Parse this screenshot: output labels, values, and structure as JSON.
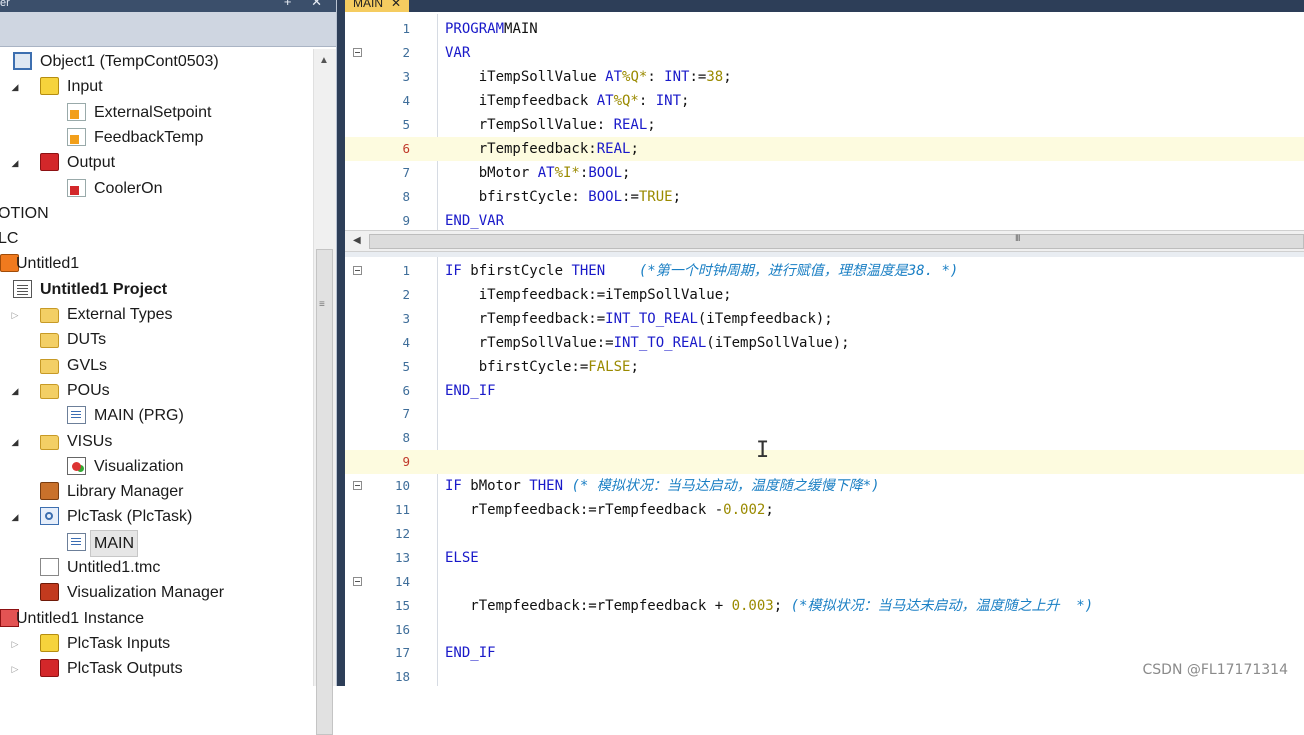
{
  "explorer": {
    "title_fragment": "er",
    "title_controls": "+ ✕",
    "items": [
      {
        "label": "Object1 (TempCont0503)",
        "icon": "object-icon",
        "expander": "",
        "bold": false,
        "selected": false
      },
      {
        "label": "Input",
        "icon": "input-image-icon",
        "expander": "◢",
        "bold": false,
        "selected": false
      },
      {
        "label": "ExternalSetpoint",
        "icon": "variable-link-icon",
        "expander": "",
        "bold": false,
        "selected": false
      },
      {
        "label": "FeedbackTemp",
        "icon": "variable-link-icon",
        "expander": "",
        "bold": false,
        "selected": false
      },
      {
        "label": "Output",
        "icon": "output-image-icon",
        "expander": "◢",
        "bold": false,
        "selected": false
      },
      {
        "label": "CoolerOn",
        "icon": "variable-link-icon",
        "expander": "",
        "bold": false,
        "selected": false
      },
      {
        "label": "OTION",
        "icon": "",
        "expander": "",
        "bold": false,
        "selected": false
      },
      {
        "label": "LC",
        "icon": "",
        "expander": "",
        "bold": false,
        "selected": false
      },
      {
        "label": "Untitled1",
        "icon": "plc-project-icon",
        "expander": "",
        "bold": false,
        "selected": false
      },
      {
        "label": "Untitled1 Project",
        "icon": "project-icon",
        "expander": "",
        "bold": true,
        "selected": false
      },
      {
        "label": "External Types",
        "icon": "folder-icon",
        "expander": "▷",
        "bold": false,
        "selected": false
      },
      {
        "label": "DUTs",
        "icon": "folder-icon",
        "expander": "",
        "bold": false,
        "selected": false
      },
      {
        "label": "GVLs",
        "icon": "folder-icon",
        "expander": "",
        "bold": false,
        "selected": false
      },
      {
        "label": "POUs",
        "icon": "folder-open-icon",
        "expander": "◢",
        "bold": false,
        "selected": false
      },
      {
        "label": "MAIN (PRG)",
        "icon": "program-icon",
        "expander": "",
        "bold": false,
        "selected": false
      },
      {
        "label": "VISUs",
        "icon": "folder-open-icon",
        "expander": "◢",
        "bold": false,
        "selected": false
      },
      {
        "label": "Visualization",
        "icon": "visualization-icon",
        "expander": "",
        "bold": false,
        "selected": false
      },
      {
        "label": "Library Manager",
        "icon": "library-icon",
        "expander": "",
        "bold": false,
        "selected": false
      },
      {
        "label": "PlcTask (PlcTask)",
        "icon": "task-icon",
        "expander": "◢",
        "bold": false,
        "selected": false
      },
      {
        "label": "MAIN",
        "icon": "program-call-icon",
        "expander": "",
        "bold": false,
        "selected": true
      },
      {
        "label": "Untitled1.tmc",
        "icon": "file-icon",
        "expander": "",
        "bold": false,
        "selected": false
      },
      {
        "label": "Visualization Manager",
        "icon": "visualization-manager-icon",
        "expander": "",
        "bold": false,
        "selected": false
      },
      {
        "label": "Untitled1 Instance",
        "icon": "instance-icon",
        "expander": "",
        "bold": false,
        "selected": false
      },
      {
        "label": "PlcTask Inputs",
        "icon": "input-image-icon",
        "expander": "▷",
        "bold": false,
        "selected": false
      },
      {
        "label": "PlcTask Outputs",
        "icon": "output-image-icon",
        "expander": "▷",
        "bold": false,
        "selected": false
      }
    ]
  },
  "editor": {
    "tab_label": "MAIN",
    "tab_close": "✕",
    "hscroll_grip": "III",
    "declaration_lines": [
      {
        "n": "1",
        "fold": false,
        "hl": false,
        "red": false,
        "tokens": [
          [
            "kw",
            "PROGRAM"
          ],
          [
            "",
            "MAIN"
          ]
        ]
      },
      {
        "n": "2",
        "fold": true,
        "hl": false,
        "red": false,
        "tokens": [
          [
            "kw",
            "VAR"
          ]
        ]
      },
      {
        "n": "3",
        "fold": false,
        "hl": false,
        "red": false,
        "tokens": [
          [
            "",
            "    iTempSollValue "
          ],
          [
            "kw",
            "AT"
          ],
          [
            "num",
            "%Q*"
          ],
          [
            "",
            ": "
          ],
          [
            "kw",
            "INT"
          ],
          [
            "",
            ":="
          ],
          [
            "num",
            "38"
          ],
          [
            "",
            ";"
          ]
        ]
      },
      {
        "n": "4",
        "fold": false,
        "hl": false,
        "red": false,
        "tokens": [
          [
            "",
            "    iTempfeedback "
          ],
          [
            "kw",
            "AT"
          ],
          [
            "num",
            "%Q*"
          ],
          [
            "",
            ": "
          ],
          [
            "kw",
            "INT"
          ],
          [
            "",
            ";"
          ]
        ]
      },
      {
        "n": "5",
        "fold": false,
        "hl": false,
        "red": false,
        "tokens": [
          [
            "",
            "    rTempSollValue: "
          ],
          [
            "kw",
            "REAL"
          ],
          [
            "",
            ";"
          ]
        ]
      },
      {
        "n": "6",
        "fold": false,
        "hl": true,
        "red": true,
        "tokens": [
          [
            "",
            "    rTempfeedback:"
          ],
          [
            "kw",
            "REAL"
          ],
          [
            "",
            ";"
          ]
        ]
      },
      {
        "n": "7",
        "fold": false,
        "hl": false,
        "red": false,
        "tokens": [
          [
            "",
            "    bMotor "
          ],
          [
            "kw",
            "AT"
          ],
          [
            "num",
            "%I*"
          ],
          [
            "",
            ":"
          ],
          [
            "kw",
            "BOOL"
          ],
          [
            "",
            ";"
          ]
        ]
      },
      {
        "n": "8",
        "fold": false,
        "hl": false,
        "red": false,
        "tokens": [
          [
            "",
            "    bfirstCycle: "
          ],
          [
            "kw",
            "BOOL"
          ],
          [
            "",
            ":="
          ],
          [
            "num",
            "TRUE"
          ],
          [
            "",
            ";"
          ]
        ]
      },
      {
        "n": "9",
        "fold": false,
        "hl": false,
        "red": false,
        "tokens": [
          [
            "kw",
            "END_VAR"
          ]
        ]
      }
    ],
    "implementation_lines": [
      {
        "n": "1",
        "fold": true,
        "hl": false,
        "red": false,
        "tokens": [
          [
            "kw",
            "IF"
          ],
          [
            "",
            " bfirstCycle "
          ],
          [
            "kw",
            "THEN"
          ],
          [
            "",
            "    "
          ],
          [
            "cm",
            "(*第一个时钟周期，进行赋值，理想温度是38. *)"
          ]
        ]
      },
      {
        "n": "2",
        "fold": false,
        "hl": false,
        "red": false,
        "tokens": [
          [
            "",
            "    iTempfeedback:=iTempSollValue;"
          ]
        ]
      },
      {
        "n": "3",
        "fold": false,
        "hl": false,
        "red": false,
        "tokens": [
          [
            "",
            "    rTempfeedback:="
          ],
          [
            "kw",
            "INT_TO_REAL"
          ],
          [
            "",
            "(iTempfeedback);"
          ]
        ]
      },
      {
        "n": "4",
        "fold": false,
        "hl": false,
        "red": false,
        "tokens": [
          [
            "",
            "    rTempSollValue:="
          ],
          [
            "kw",
            "INT_TO_REAL"
          ],
          [
            "",
            "(iTempSollValue);"
          ]
        ]
      },
      {
        "n": "5",
        "fold": false,
        "hl": false,
        "red": false,
        "tokens": [
          [
            "",
            "    bfirstCycle:="
          ],
          [
            "num",
            "FALSE"
          ],
          [
            "",
            ";"
          ]
        ]
      },
      {
        "n": "6",
        "fold": false,
        "hl": false,
        "red": false,
        "tokens": [
          [
            "kw",
            "END_IF"
          ]
        ]
      },
      {
        "n": "7",
        "fold": false,
        "hl": false,
        "red": false,
        "tokens": []
      },
      {
        "n": "8",
        "fold": false,
        "hl": false,
        "red": false,
        "tokens": []
      },
      {
        "n": "9",
        "fold": false,
        "hl": true,
        "red": true,
        "tokens": []
      },
      {
        "n": "10",
        "fold": true,
        "hl": false,
        "red": false,
        "tokens": [
          [
            "kw",
            "IF"
          ],
          [
            "",
            " bMotor "
          ],
          [
            "kw",
            "THEN"
          ],
          [
            "",
            " "
          ],
          [
            "cm",
            "(* 模拟状况：当马达启动，温度随之缓慢下降*)"
          ]
        ]
      },
      {
        "n": "11",
        "fold": false,
        "hl": false,
        "red": false,
        "tokens": [
          [
            "",
            "   rTempfeedback:=rTempfeedback -"
          ],
          [
            "num",
            "0.002"
          ],
          [
            "",
            ";"
          ]
        ]
      },
      {
        "n": "12",
        "fold": false,
        "hl": false,
        "red": false,
        "tokens": []
      },
      {
        "n": "13",
        "fold": false,
        "hl": false,
        "red": false,
        "tokens": [
          [
            "kw",
            "ELSE"
          ]
        ]
      },
      {
        "n": "14",
        "fold": true,
        "hl": false,
        "red": false,
        "tokens": []
      },
      {
        "n": "15",
        "fold": false,
        "hl": false,
        "red": false,
        "tokens": [
          [
            "",
            "   rTempfeedback:=rTempfeedback + "
          ],
          [
            "num",
            "0.003"
          ],
          [
            "",
            "; "
          ],
          [
            "cm",
            "(*模拟状况：当马达未启动，温度随之上升  *)"
          ]
        ]
      },
      {
        "n": "16",
        "fold": false,
        "hl": false,
        "red": false,
        "tokens": []
      },
      {
        "n": "17",
        "fold": false,
        "hl": false,
        "red": false,
        "tokens": [
          [
            "kw",
            "END_IF"
          ]
        ]
      },
      {
        "n": "18",
        "fold": false,
        "hl": false,
        "red": false,
        "tokens": []
      }
    ]
  },
  "watermark": "CSDN @FL17171314"
}
